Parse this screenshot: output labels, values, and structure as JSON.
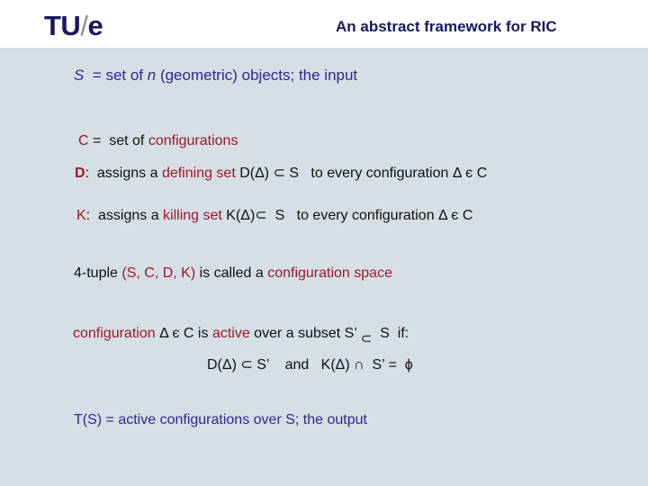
{
  "header": {
    "logo": {
      "part1": "TU",
      "slash": "/",
      "part2": "e"
    },
    "title": "An abstract framework for RIC"
  },
  "colors": {
    "background": "#d5dfe5",
    "header_background": "#ffffff",
    "navy": "#1a1760",
    "blue_text": "#2a2a8f",
    "red_highlight": "#a01826",
    "body_text": "#111111"
  },
  "lines": {
    "s_def": {
      "sym": "S",
      "mid1": "  = set of ",
      "n": "n",
      "mid2": " (geometric) objects; the input"
    },
    "c_def": {
      "c": "C",
      "eq": " =  set of ",
      "configs": "configurations"
    },
    "d_def": {
      "d": "D",
      "a": ":  assigns a ",
      "defining": "defining set",
      "b": " D(Δ) ⊂ S   to every configuration Δ є C"
    },
    "k_def": {
      "k": "K",
      "a": ":  assigns a ",
      "killing": "killing set",
      "b": " K(Δ)⊂  S   to every configuration Δ є C"
    },
    "tuple": {
      "a": "4-tuple ",
      "tuple": "(S, C, D, K)",
      "b": " is called a ",
      "space": "configuration space"
    },
    "active": {
      "config": "configuration",
      "a": " Δ є C is ",
      "active": "active",
      "b": " over a subset S’ ",
      "subset": "⊂",
      "c": "  S  if:"
    },
    "condition": "D(Δ) ⊂ S’    and   K(Δ) ∩  S’ =  ϕ",
    "output": "T(S) = active configurations over S; the output"
  }
}
